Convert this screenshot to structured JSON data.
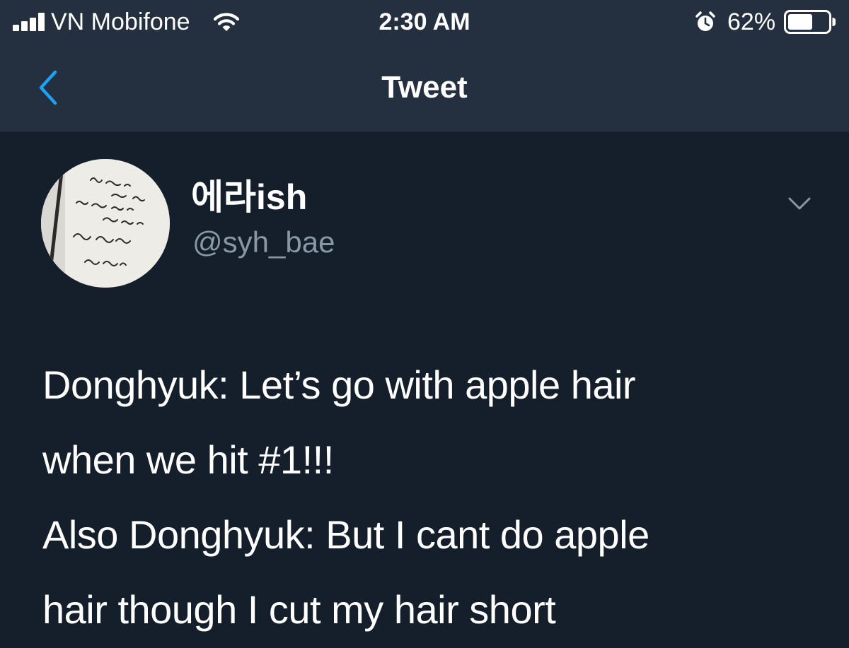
{
  "status_bar": {
    "carrier": "VN Mobifone",
    "time": "2:30 AM",
    "battery_percent": "62%",
    "battery_level": 0.62,
    "signal_icon": "signal-bars-icon",
    "wifi_icon": "wifi-icon",
    "alarm_icon": "alarm-clock-icon",
    "battery_icon": "battery-icon"
  },
  "nav": {
    "title": "Tweet",
    "back_icon": "chevron-left-icon",
    "accent_color": "#1da1f2"
  },
  "tweet": {
    "display_name": "에라ish",
    "handle": "@syh_bae",
    "menu_icon": "chevron-down-icon",
    "avatar_icon": "handwritten-note-avatar",
    "lines": [
      "Donghyuk: Let’s go with apple hair",
      "when we hit #1!!!",
      "Also Donghyuk: But I cant do apple",
      "hair though I cut my hair short"
    ]
  },
  "colors": {
    "background": "#151f2b",
    "bar_background": "#24303f",
    "secondary_text": "#8899a6",
    "primary_text": "#ffffff"
  }
}
